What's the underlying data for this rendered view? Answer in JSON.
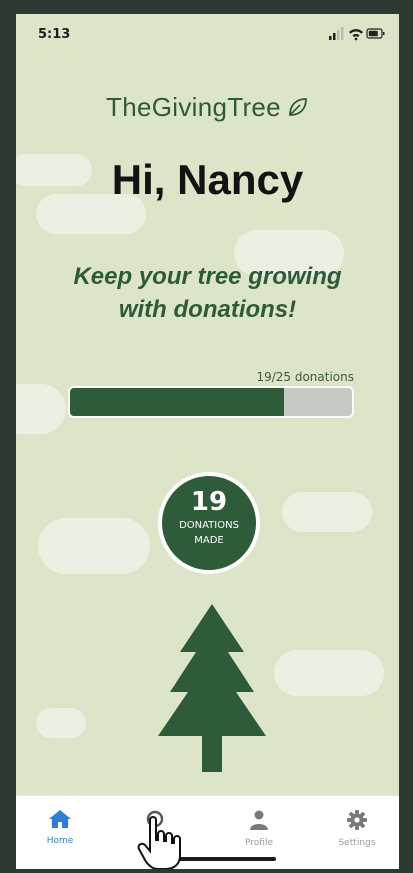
{
  "status": {
    "time": "5:13"
  },
  "app": {
    "brand": "TheGivingTree",
    "greeting": "Hi, Nancy",
    "tagline_line1": "Keep your tree growing",
    "tagline_line2": "with donations!"
  },
  "progress": {
    "label": "19/25 donations",
    "current": 19,
    "goal": 25
  },
  "donations": {
    "count": "19",
    "caption_line1": "DONATIONS",
    "caption_line2": "MADE"
  },
  "tabs": [
    {
      "label": "Home",
      "icon": "home-icon",
      "active": true
    },
    {
      "label": "Br",
      "icon": "browse-icon",
      "active": false
    },
    {
      "label": "Profile",
      "icon": "profile-icon",
      "active": false
    },
    {
      "label": "Settings",
      "icon": "gear-icon",
      "active": false
    }
  ],
  "colors": {
    "background": "#dde5c9",
    "accent_green": "#2e5b3a",
    "active_tab": "#2f7fd1"
  }
}
